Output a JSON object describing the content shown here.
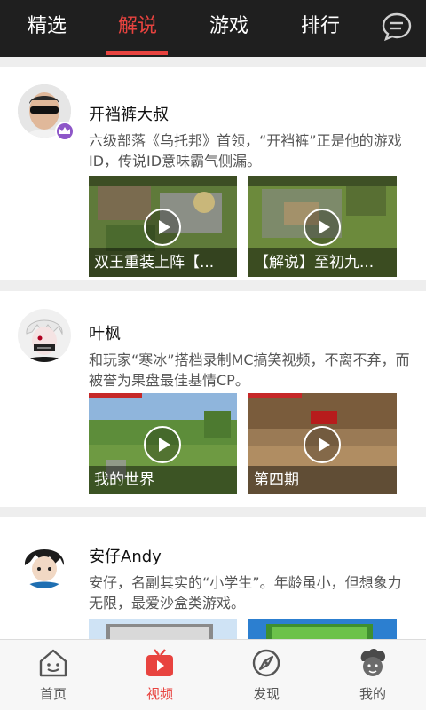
{
  "header": {
    "tabs": [
      {
        "label": "精选",
        "active": false
      },
      {
        "label": "解说",
        "active": true
      },
      {
        "label": "游戏",
        "active": false
      },
      {
        "label": "排行",
        "active": false
      }
    ],
    "chat_icon": "chat-bubble-icon"
  },
  "cards": [
    {
      "name": "开裆裤大叔",
      "description": "六级部落《乌托邦》首领，“开裆裤”正是他的游戏ID，传说ID意味霸气侧漏。",
      "badge_icon": "crown-icon",
      "videos": [
        {
          "caption": "双王重装上阵【..."
        },
        {
          "caption": "【解说】至初九..."
        }
      ]
    },
    {
      "name": "叶枫",
      "description": "和玩家“寒冰”搭档录制MC搞笑视频，不离不弃，而被誉为果盘最佳基情CP。",
      "videos": [
        {
          "caption": "我的世界"
        },
        {
          "caption": "第四期"
        }
      ]
    },
    {
      "name": "安仔Andy",
      "description": "安仔，名副其实的“小学生”。年龄虽小，但想象力无限，最爱沙盒类游戏。",
      "videos": [
        {
          "caption": ""
        },
        {
          "caption": ""
        }
      ]
    }
  ],
  "bottom_nav": [
    {
      "label": "首页",
      "icon": "home-icon",
      "active": false
    },
    {
      "label": "视频",
      "icon": "tv-icon",
      "active": true
    },
    {
      "label": "发现",
      "icon": "compass-icon",
      "active": false
    },
    {
      "label": "我的",
      "icon": "profile-icon",
      "active": false
    }
  ],
  "colors": {
    "accent": "#e8433f",
    "topbar": "#1f1f1f",
    "crown_badge": "#8e57c8"
  }
}
